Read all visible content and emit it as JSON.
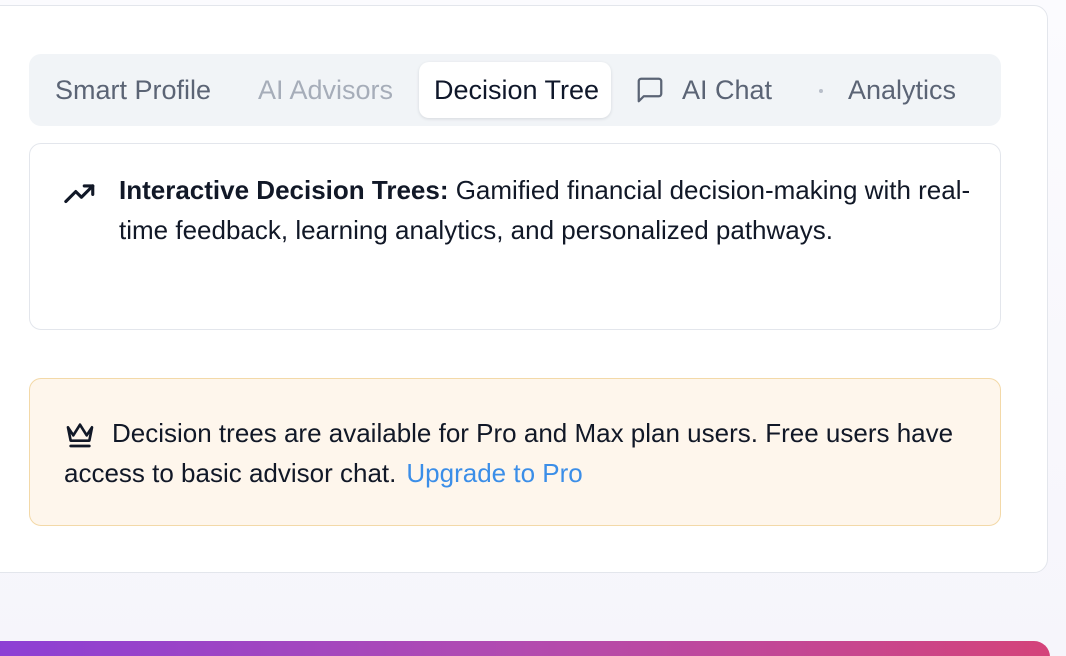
{
  "tabs": [
    {
      "label": "Smart Profile",
      "state": "normal"
    },
    {
      "label": "AI Advisors",
      "state": "disabled"
    },
    {
      "label": "Decision Tree",
      "state": "active"
    },
    {
      "label": "AI Chat",
      "state": "normal",
      "icon": "message-square-icon"
    },
    {
      "label": "Analytics",
      "state": "normal"
    }
  ],
  "info": {
    "icon": "trending-up-icon",
    "title": "Interactive Decision Trees:",
    "body": " Gamified financial decision-making with real-time feedback, learning analytics, and personalized pathways."
  },
  "upgrade": {
    "icon": "crown-icon",
    "message": "Decision trees are available for Pro and Max plan users. Free users have access to basic advisor chat.",
    "link_label": "Upgrade to Pro"
  },
  "colors": {
    "accent_link": "#3b8ee8",
    "warning_bg": "#fef6ec",
    "warning_border": "#f3d9a8",
    "tab_bg": "#f1f4f7",
    "gradient_start": "#8b3fd6",
    "gradient_end": "#d4437a"
  }
}
